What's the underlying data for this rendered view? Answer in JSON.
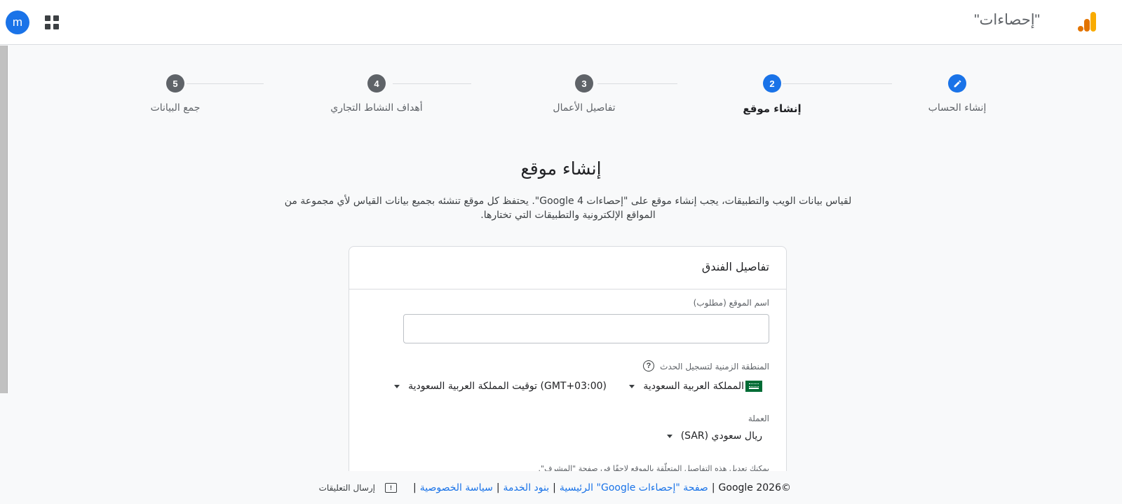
{
  "header": {
    "avatar_letter": "m",
    "product_name": "\"إحصاءات\"",
    "apps_icon": "apps-grid-icon",
    "logo_icon": "analytics-logo-icon"
  },
  "stepper": {
    "steps": [
      {
        "number": "",
        "label": "إنشاء الحساب",
        "state": "completed",
        "icon": "pencil-icon"
      },
      {
        "number": "2",
        "label": "إنشاء موقع",
        "state": "current"
      },
      {
        "number": "3",
        "label": "تفاصيل الأعمال",
        "state": "pending"
      },
      {
        "number": "4",
        "label": "أهداف النشاط التجاري",
        "state": "pending"
      },
      {
        "number": "5",
        "label": "جمع البيانات",
        "state": "pending"
      }
    ]
  },
  "main": {
    "heading": "إنشاء موقع",
    "intro_line1": "لقياس بيانات الويب والتطبيقات، يجب إنشاء موقع على \"إحصاءات Google 4\". يحتفظ كل موقع تنشئه بجميع بيانات القياس لأي مجموعة من",
    "intro_line2": "المواقع الإلكترونية والتطبيقات التي تختارها."
  },
  "card": {
    "title": "تفاصيل الفندق",
    "property_name_label": "اسم الموقع (مطلوب)",
    "property_name_value": "",
    "timezone_label": "المنطقة الزمنية لتسجيل الحدث",
    "country_value": "المملكة العربية السعودية",
    "timezone_value": "(GMT+03:00) توقيت المملكة العربية السعودية",
    "currency_label": "العملة",
    "currency_value": "ريال سعودي (SAR)",
    "note": "يمكنك تعديل هذه التفاصيل المتعلّقة بالموقع لاحقًا في صفحة \"المشرف\"."
  },
  "footer": {
    "copyright": "©2026 Google",
    "link_home": "صفحة \"إحصاءات Google\" الرئيسية",
    "link_terms": "بنود الخدمة",
    "link_privacy": "سياسة الخصوصية",
    "feedback_label": "إرسال التعليقات"
  },
  "colors": {
    "accent": "#1a73e8",
    "step_pending": "#5f6368",
    "logo_orange_dark": "#e37400",
    "logo_orange_light": "#f9ab00"
  }
}
